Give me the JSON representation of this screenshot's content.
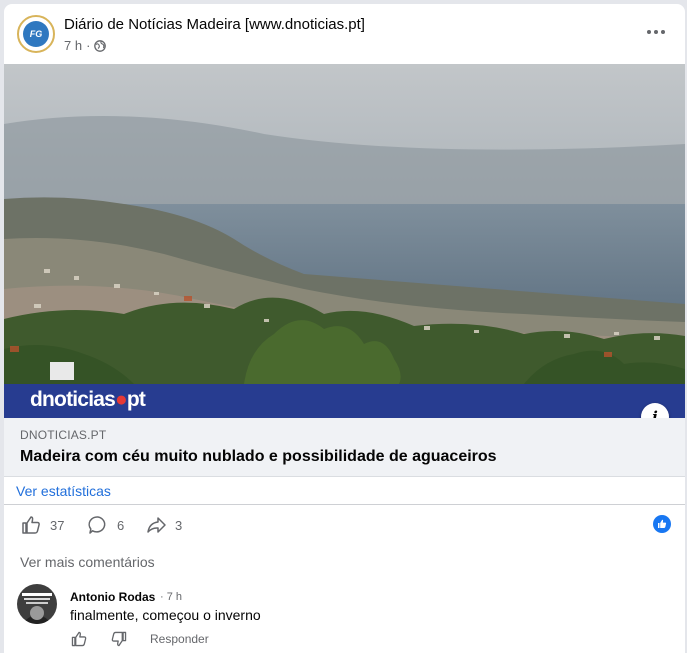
{
  "post": {
    "page_name": "Diário de Notícias Madeira [www.dnoticias.pt]",
    "time": "7 h",
    "time_separator": "·",
    "logo_text": "FG"
  },
  "image": {
    "brand_main": "dnoticias",
    "brand_suffix": "pt"
  },
  "link": {
    "domain": "DNOTICIAS.PT",
    "title": "Madeira com céu muito nublado e possibilidade de aguaceiros"
  },
  "stats": {
    "label": "Ver estatísticas"
  },
  "actions": {
    "likes": "37",
    "comments": "6",
    "shares": "3"
  },
  "comments": {
    "more_label": "Ver mais comentários",
    "items": [
      {
        "author": "Antonio Rodas",
        "time": "· 7 h",
        "text": "finalmente, começou o inverno",
        "reply_label": "Responder"
      }
    ]
  },
  "colors": {
    "link_blue": "#216fdb",
    "fb_blue": "#1877f2",
    "brand_band": "#273c90"
  }
}
